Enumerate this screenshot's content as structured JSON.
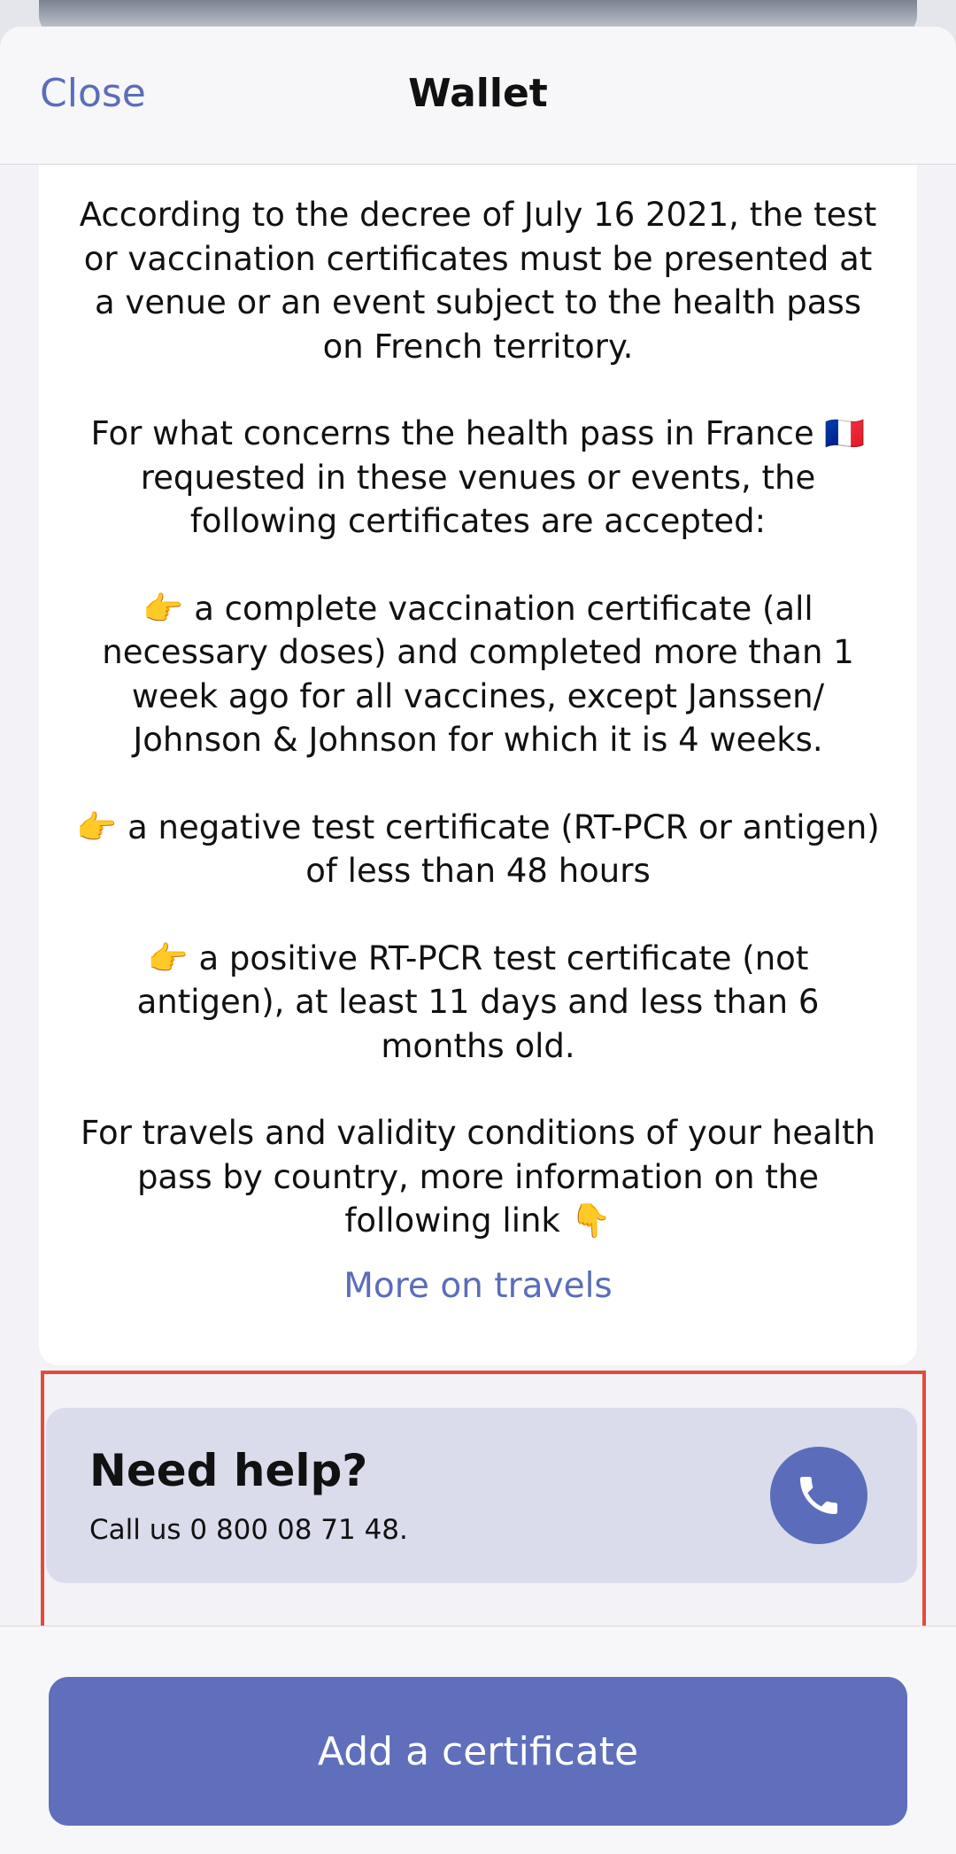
{
  "nav": {
    "close_label": "Close",
    "title": "Wallet"
  },
  "info": {
    "paragraphs": [
      "According to the decree of July 16 2021, the test or vaccination certificates must be presented at a venue or an event subject to the health pass on French territory.",
      "For what concerns the health pass in France 🇫🇷 requested in these venues or events, the following certificates are accepted:",
      "👉 a complete vaccination certificate (all necessary doses) and completed more than 1 week ago for all vaccines, except Janssen/ Johnson & Johnson for which it is 4 weeks.",
      "👉 a negative test certificate (RT-PCR or antigen) of less than 48 hours",
      "👉 a positive RT-PCR test certificate (not antigen), at least 11 days and less than 6 months old.",
      "For travels and validity conditions of your health pass by country, more information on the following link 👇"
    ],
    "link_label": "More on travels"
  },
  "help": {
    "title": "Need help?",
    "subtitle": "Call us 0 800 08 71 48.",
    "icon": "phone-icon"
  },
  "footer": {
    "add_label": "Add a certificate"
  },
  "colors": {
    "accent": "#5b6dba",
    "help_bg": "#dadcec",
    "highlight": "#e44a3c"
  }
}
